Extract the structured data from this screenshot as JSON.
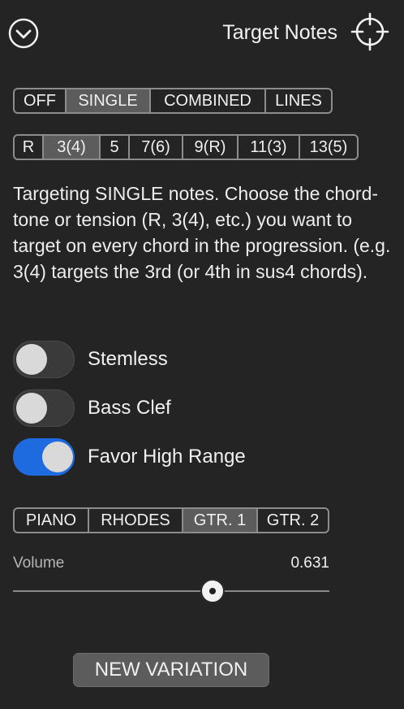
{
  "header": {
    "title": "Target Notes"
  },
  "modes": {
    "items": [
      "OFF",
      "SINGLE",
      "COMBINED",
      "LINES"
    ],
    "selected": "SINGLE"
  },
  "tones": {
    "items": [
      "R",
      "3(4)",
      "5",
      "7(6)",
      "9(R)",
      "11(3)",
      "13(5)"
    ],
    "selected": "3(4)"
  },
  "description": "Targeting SINGLE notes. Choose the chord-tone or tension (R, 3(4), etc.) you want to target on every chord in the progression. (e.g. 3(4) targets the 3rd (or 4th in sus4 chords).",
  "toggles": [
    {
      "label": "Stemless",
      "on": false
    },
    {
      "label": "Bass Clef",
      "on": false
    },
    {
      "label": "Favor High Range",
      "on": true
    }
  ],
  "instruments": {
    "items": [
      "PIANO",
      "RHODES",
      "GTR. 1",
      "GTR. 2"
    ],
    "selected": "GTR. 1"
  },
  "volume": {
    "label": "Volume",
    "value": "0.631",
    "fraction": 0.631
  },
  "new_variation_label": "NEW VARIATION",
  "colors": {
    "background": "#242424",
    "accent": "#1e6be0",
    "selected_segment": "#5c5c5c"
  }
}
